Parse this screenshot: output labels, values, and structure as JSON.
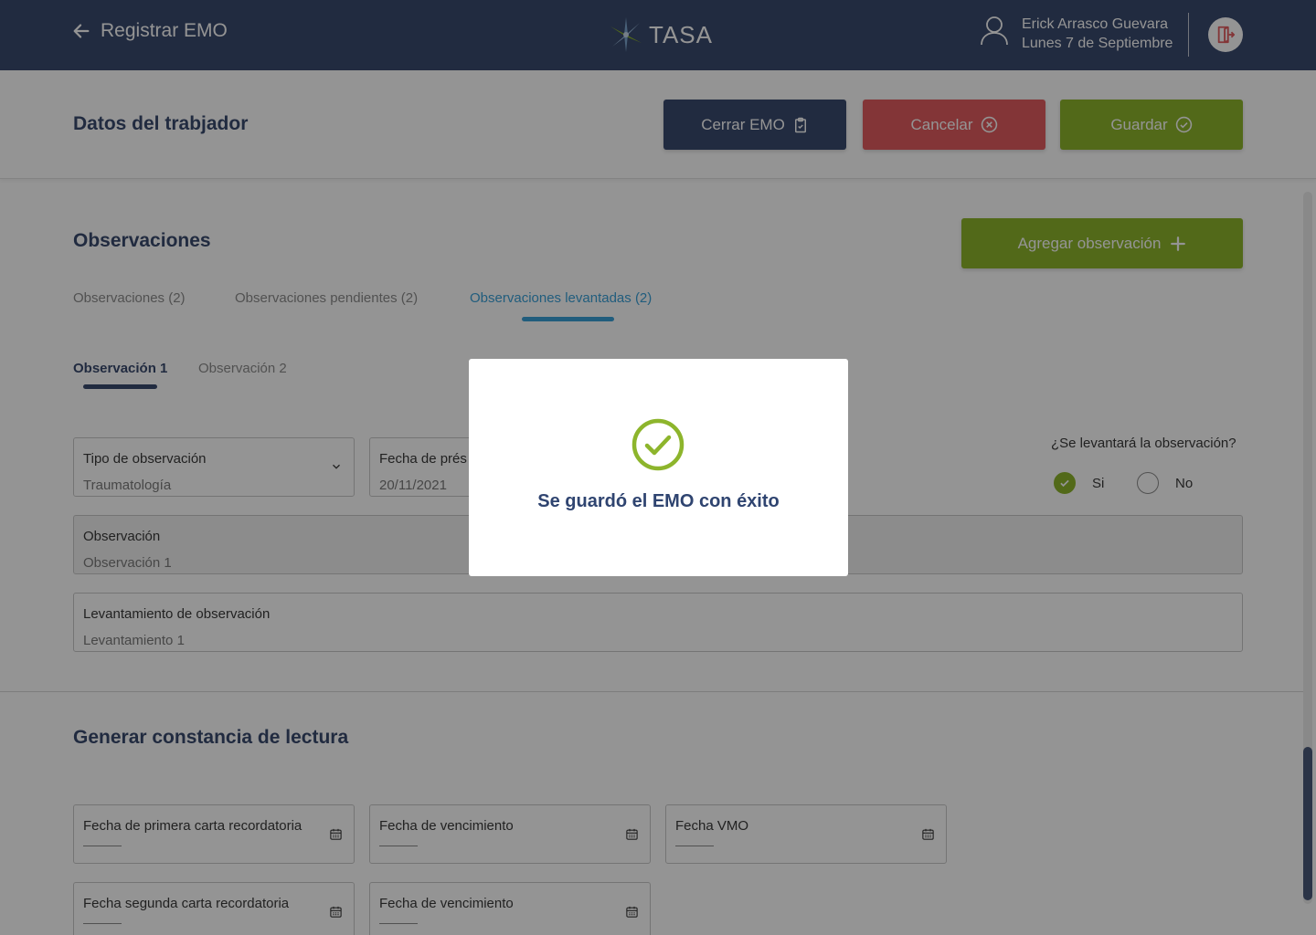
{
  "topbar": {
    "back_label": "Registrar EMO",
    "logo_text": "TASA",
    "user_name": "Erick Arrasco Guevara",
    "user_date": "Lunes 7 de Septiembre"
  },
  "header": {
    "title": "Datos del trabjador",
    "cerrar_label": "Cerrar EMO",
    "cancelar_label": "Cancelar",
    "guardar_label": "Guardar"
  },
  "observaciones": {
    "title": "Observaciones",
    "add_label": "Agregar observación",
    "tabs": [
      {
        "label": "Observaciones (2)"
      },
      {
        "label": "Observaciones pendientes (2)"
      },
      {
        "label": "Observaciones levantadas (2)"
      }
    ],
    "subtabs": [
      {
        "label": "Observación 1"
      },
      {
        "label": "Observación 2"
      }
    ],
    "tipo": {
      "label": "Tipo de observación",
      "value": "Traumatología"
    },
    "fecha": {
      "label": "Fecha de prés",
      "value": "20/11/2021"
    },
    "observacion": {
      "label": "Observación",
      "value": "Observación 1"
    },
    "levantamiento": {
      "label": "Levantamiento de observación",
      "value": "Levantamiento 1"
    },
    "question": "¿Se levantará la observación?",
    "yes_label": "Si",
    "no_label": "No"
  },
  "constancia": {
    "title": "Generar constancia de lectura",
    "fields": [
      {
        "label": "Fecha de primera carta recordatoria"
      },
      {
        "label": "Fecha de vencimiento"
      },
      {
        "label": "Fecha VMO"
      },
      {
        "label": "Fecha segunda carta recordatoria"
      },
      {
        "label": "Fecha de vencimiento"
      }
    ]
  },
  "modal": {
    "message": "Se guardó el EMO con éxito"
  },
  "colors": {
    "navy": "#3a4a6e",
    "red": "#e25c5f",
    "green": "#8db52c",
    "accent_blue": "#3aa0d8"
  }
}
